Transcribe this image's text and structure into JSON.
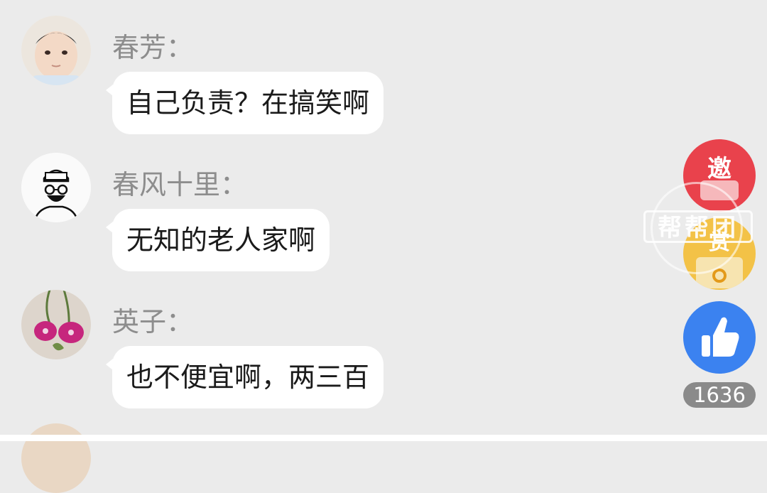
{
  "messages": [
    {
      "name": "春芳：",
      "text": "自己负责？在搞笑啊"
    },
    {
      "name": "春风十里：",
      "text": "无知的老人家啊"
    },
    {
      "name": "英子：",
      "text": "也不便宜啊，两三百"
    }
  ],
  "sidebar": {
    "invite_label": "邀",
    "gift_label": "赏",
    "like_count": "1636",
    "like_icon": "thumbs-up-icon",
    "invite_color": "#e9424c",
    "gift_color": "#f3c247",
    "like_color": "#3b82f0"
  },
  "watermark": {
    "text": "帮帮团"
  }
}
